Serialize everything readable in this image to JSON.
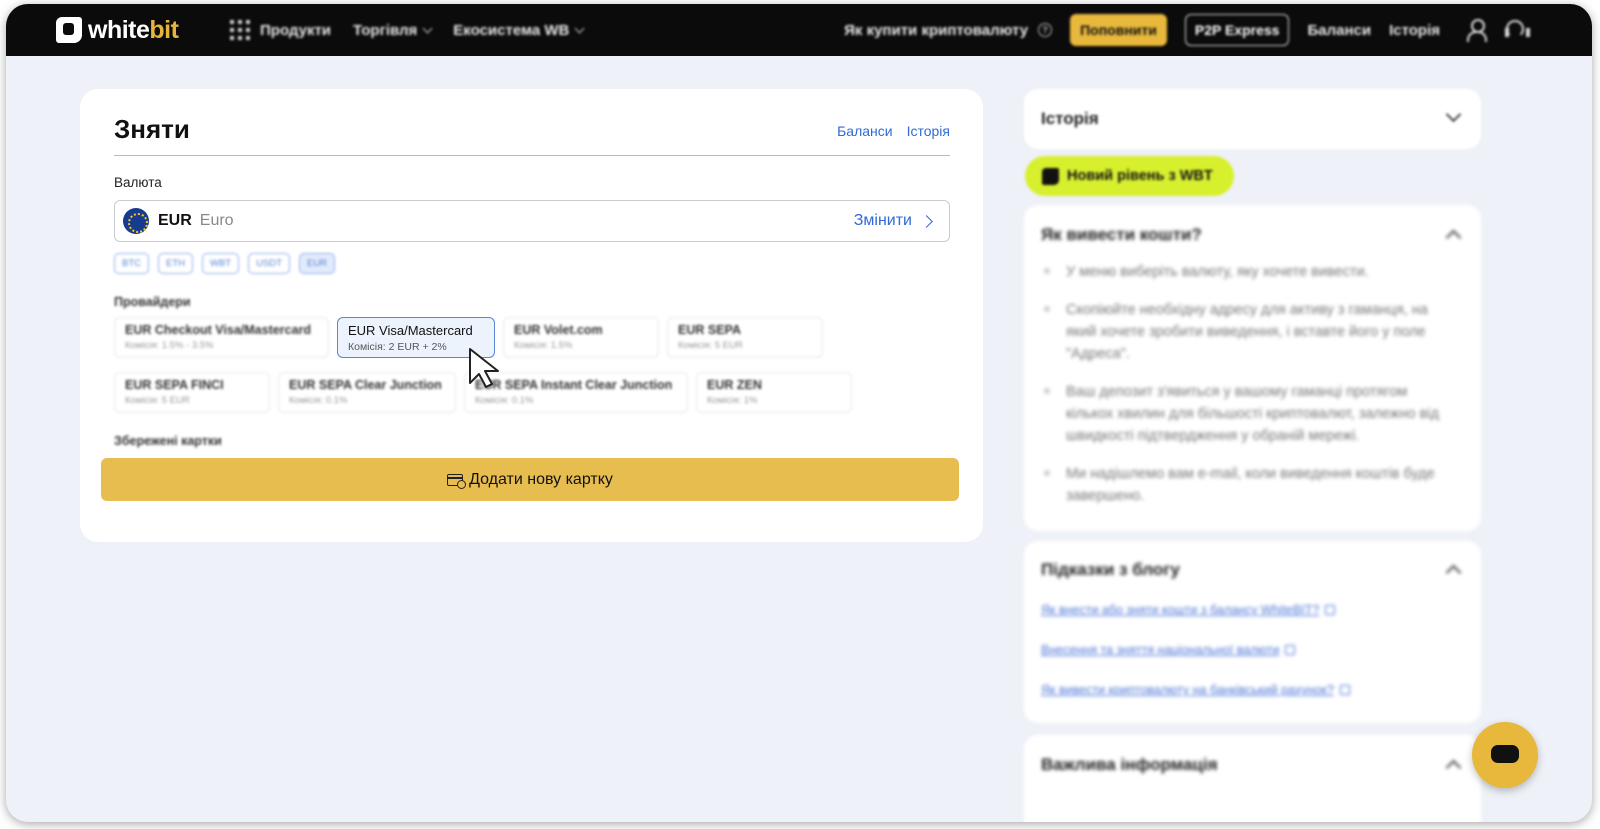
{
  "header": {
    "logo_white": "white",
    "logo_bit": "bit",
    "nav_left": [
      "Продукти",
      "Торгівля",
      "Екосистема WB"
    ],
    "how_to_buy": "Як купити криптовалюту",
    "topup": "Поповнити",
    "p2p": "P2P Express",
    "balances": "Баланси",
    "history": "Історія"
  },
  "withdraw": {
    "title": "Зняти",
    "link_balances": "Баланси",
    "link_history": "Історія",
    "currency_label": "Валюта",
    "currency_code": "EUR",
    "currency_name": "Euro",
    "change_label": "Змінити",
    "quick_chips": [
      "BTC",
      "ETH",
      "WBT",
      "USDT",
      "EUR"
    ],
    "providers_label": "Провайдери",
    "providers": [
      {
        "name": "EUR Checkout Visa/Mastercard",
        "fee": "Комісія: 1.5% - 3.5%"
      },
      {
        "name": "EUR Visa/Mastercard",
        "fee": "Комісія: 2 EUR + 2%"
      },
      {
        "name": "EUR Volet.com",
        "fee": "Комісія: 1.5%"
      },
      {
        "name": "EUR SEPA",
        "fee": "Комісія: 5 EUR"
      },
      {
        "name": "EUR SEPA FINCI",
        "fee": "Комісія: 5 EUR"
      },
      {
        "name": "EUR SEPA Clear Junction",
        "fee": "Комісія: 0.1%"
      },
      {
        "name": "EUR SEPA Instant Clear Junction",
        "fee": "Комісія: 0.1%"
      },
      {
        "name": "EUR ZEN",
        "fee": "Комісія: 1%"
      }
    ],
    "saved_cards_label": "Збережені картки",
    "add_card": "Додати нову картку"
  },
  "sidebar": {
    "history_title": "Історія",
    "wbt_badge": "Новий рівень з WBT",
    "howto_title": "Як вивести кошти?",
    "howto_steps": [
      "У меню виберіть валюту, яку хочете вивести.",
      "Скопіюйте необхідну адресу для активу з гаманця, на який хочете зробити виведення, і вставте його у поле \"Адреса\".",
      "Ваш депозит з'явиться у вашому гаманці протягом кількох хвилин для більшості криптовалют, залежно від швидкості підтвердження у обраній мережі.",
      "Ми надішлемо вам e-mail, коли виведення коштів буде завершено."
    ],
    "blog_title": "Підказки з блогу",
    "blog_links": [
      "Як внести або зняти кошти з балансу WhiteBIT?",
      "Внесення та зняття національної валюти",
      "Як вивести криптовалюту на банківський рахунок?"
    ],
    "important_title": "Важлива інформація"
  },
  "icons": {
    "products": "grid-icon",
    "help": "question-icon",
    "user": "user-icon",
    "support": "headset-icon",
    "chat": "chat-icon"
  },
  "colors": {
    "accent_yellow": "#e8bd50",
    "link_blue": "#2f6ad7",
    "wbt_green": "#d8ef2e",
    "header_bg": "#0b0b0b"
  }
}
